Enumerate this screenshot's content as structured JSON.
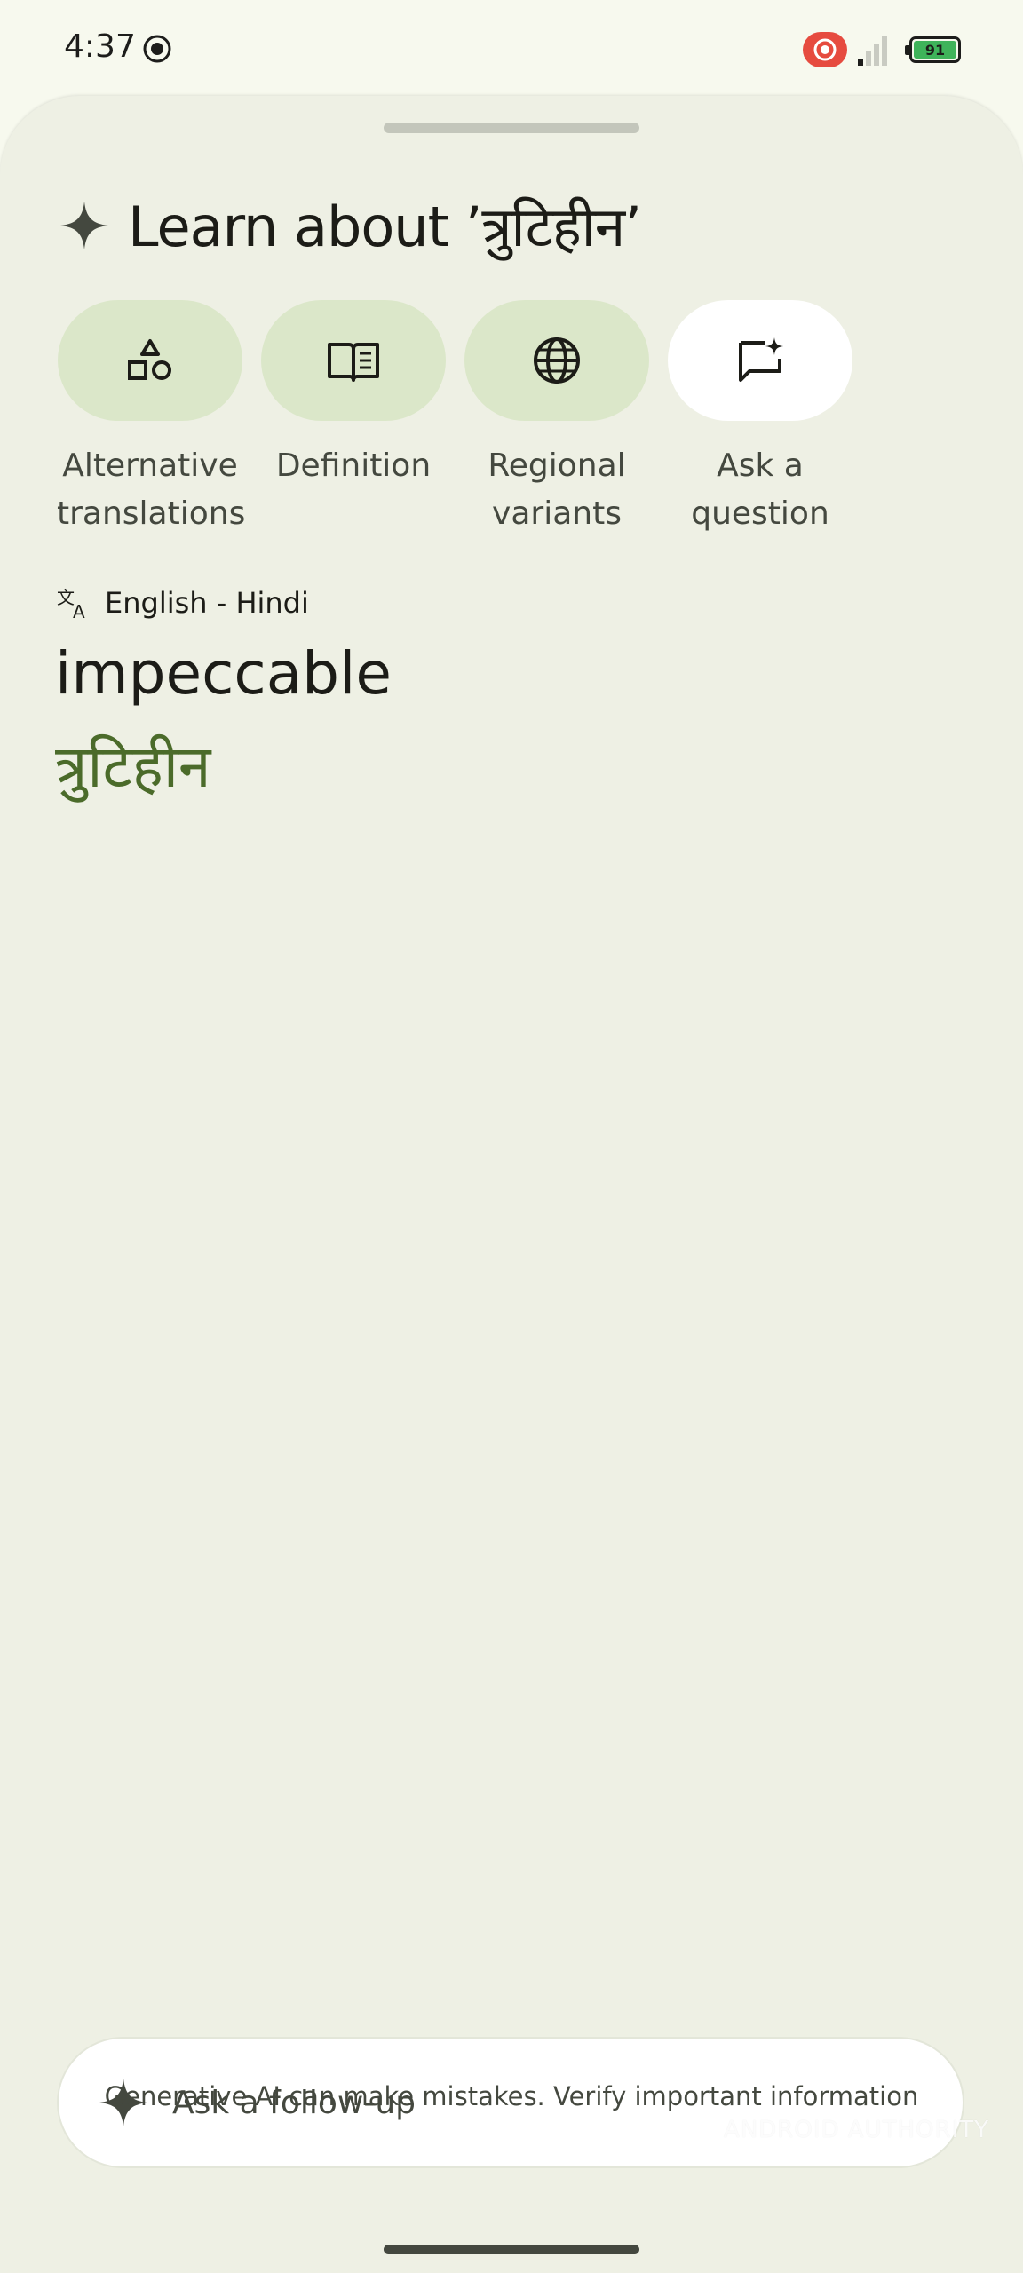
{
  "status_bar": {
    "time": "4:37",
    "battery_level": "91"
  },
  "sheet": {
    "title": "Learn about ’त्रुटिहीन’"
  },
  "chips": [
    {
      "label": "Alternative translations",
      "icon": "shapes-icon"
    },
    {
      "label": "Definition",
      "icon": "book-icon"
    },
    {
      "label": "Regional variants",
      "icon": "globe-icon"
    },
    {
      "label": "Ask a question",
      "icon": "chat-sparkle-icon"
    }
  ],
  "translation": {
    "language_pair": "English - Hindi",
    "source_word": "impeccable",
    "target_word": "त्रुटिहीन"
  },
  "followup": {
    "placeholder": "Ask a follow-up"
  },
  "disclaimer": "Generative AI can make mistakes. Verify important information",
  "watermark": "ANDROID AUTHORITY",
  "colors": {
    "sheet_bg": "#eef0e4",
    "chip_bg": "#dbe7c9",
    "accent_green": "#4b6b2a",
    "record_red": "#e64b3f",
    "battery_green": "#3fb35a"
  }
}
